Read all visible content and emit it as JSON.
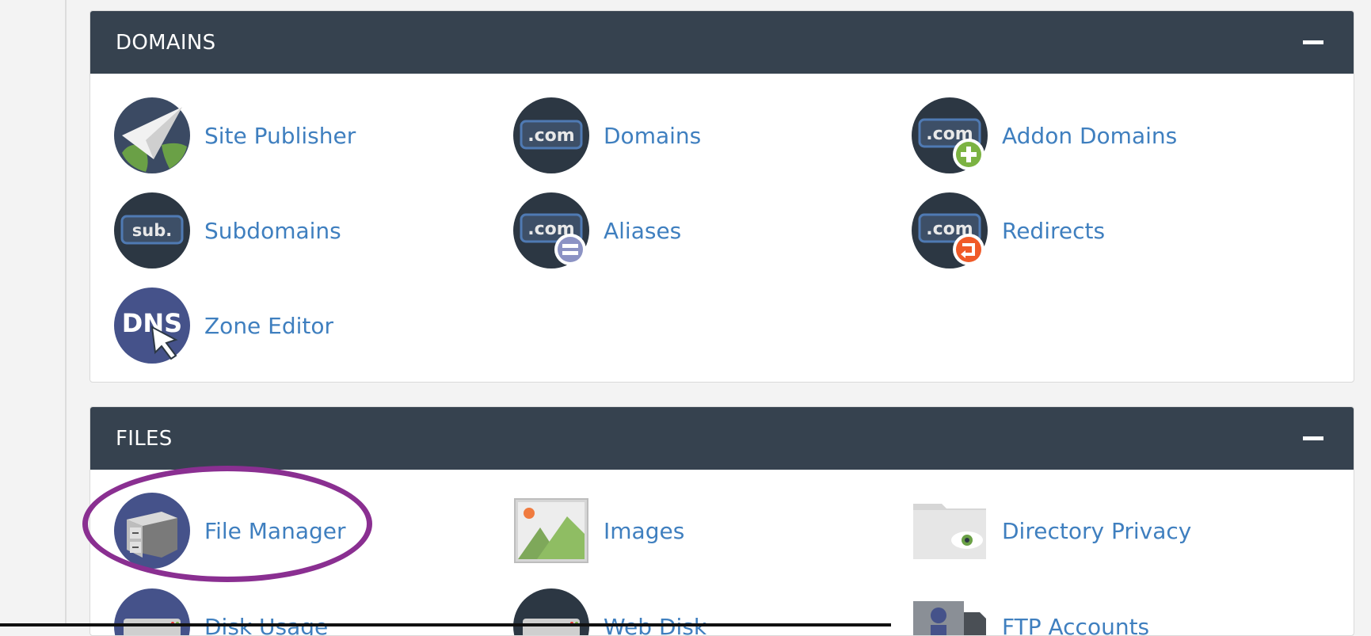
{
  "domains": {
    "title": "DOMAINS",
    "items": [
      {
        "label": "Site Publisher",
        "icon": "paper-plane-globe-icon"
      },
      {
        "label": "Domains",
        "icon": "dotcom-icon"
      },
      {
        "label": "Addon Domains",
        "icon": "dotcom-add-icon"
      },
      {
        "label": "Subdomains",
        "icon": "sub-icon"
      },
      {
        "label": "Aliases",
        "icon": "dotcom-equals-icon"
      },
      {
        "label": "Redirects",
        "icon": "dotcom-redirect-icon"
      },
      {
        "label": "Zone Editor",
        "icon": "dns-icon"
      }
    ]
  },
  "files": {
    "title": "FILES",
    "items": [
      {
        "label": "File Manager",
        "icon": "file-cabinet-icon"
      },
      {
        "label": "Images",
        "icon": "image-icon"
      },
      {
        "label": "Directory Privacy",
        "icon": "folder-eye-icon"
      },
      {
        "label": "Disk Usage",
        "icon": "disk-icon"
      },
      {
        "label": "Web Disk",
        "icon": "web-disk-icon"
      },
      {
        "label": "FTP Accounts",
        "icon": "ftp-icon"
      }
    ]
  },
  "icon_text": {
    "dotcom": ".com",
    "sub": "sub.",
    "dns": "DNS"
  },
  "colors": {
    "header_bg": "#36424f",
    "link": "#3f7fbf",
    "highlight": "#8a2f91"
  }
}
